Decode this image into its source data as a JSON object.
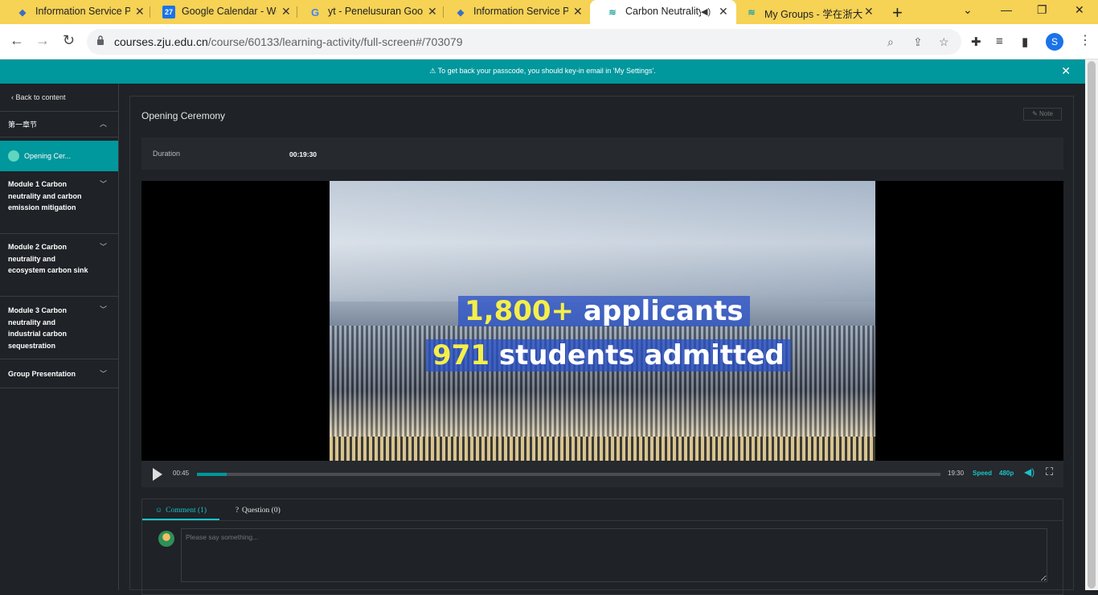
{
  "browser": {
    "tabs": [
      {
        "title": "Information Service Pl",
        "icon": "zju-logo-icon"
      },
      {
        "title": "Google Calendar - We",
        "icon": "calendar-icon"
      },
      {
        "title": "yt - Penelusuran Goog",
        "icon": "google-icon"
      },
      {
        "title": "Information Service Pl",
        "icon": "zju-logo-icon"
      },
      {
        "title": "Carbon Neutrality",
        "icon": "course-icon",
        "active": true
      },
      {
        "title": "My Groups - 学在浙大",
        "icon": "course-icon"
      }
    ],
    "calendar_badge": "27",
    "url_host": "courses.zju.edu.cn",
    "url_path": "/course/60133/learning-activity/full-screen#/703079",
    "profile_initial": "S"
  },
  "notice": {
    "text": "⚠ To get back your passcode, you should key-in email in 'My Settings'."
  },
  "sidebar": {
    "back_label": "Back to content",
    "section_label": "第一章节",
    "active_item": "Opening Cer...",
    "modules": [
      {
        "label": "Module 1 Carbon neutrality and carbon emission mitigation"
      },
      {
        "label": "Module 2 Carbon neutrality and ecosystem carbon sink"
      },
      {
        "label": "Module 3 Carbon neutrality and industrial carbon sequestration"
      },
      {
        "label": "Group Presentation"
      }
    ]
  },
  "activity": {
    "title": "Opening Ceremony",
    "note_label": "Note",
    "duration_label": "Duration",
    "duration_value": "00:19:30"
  },
  "video": {
    "caption_line1_num": "1,800+",
    "caption_line1_text": "applicants",
    "caption_line2_num": "971",
    "caption_line2_text": "students admitted",
    "current_time": "00:45",
    "total_time": "19:30",
    "progress": 0.04,
    "speed_label": "Speed",
    "quality_label": "480p"
  },
  "comments": {
    "tab_comment": "Comment (1)",
    "tab_question": "Question (0)",
    "placeholder": "Please say something..."
  },
  "colors": {
    "accent": "#00979d",
    "tabbar": "#f6d255",
    "bg": "#1f2226"
  }
}
